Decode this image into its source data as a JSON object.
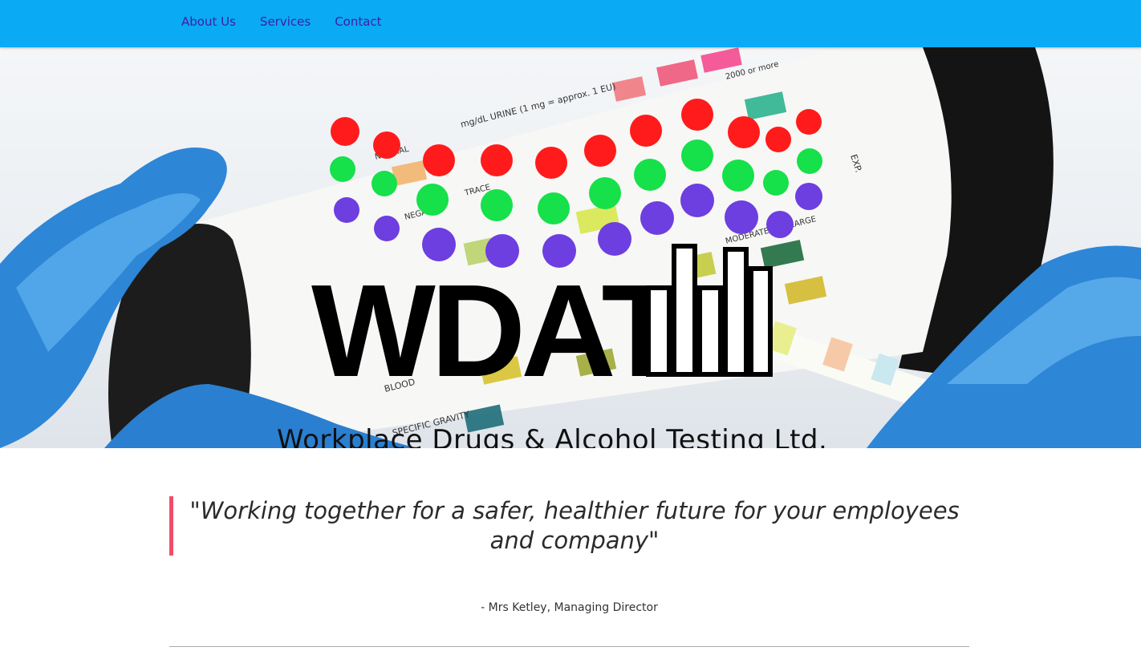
{
  "nav": {
    "items": [
      {
        "label": "About Us"
      },
      {
        "label": "Services"
      },
      {
        "label": "Contact"
      }
    ]
  },
  "hero": {
    "logo_text": "WDAT",
    "tagline": "Workplace Drugs & Alcohol Testing Ltd.",
    "strip_labels": [
      "mg/dL URINE (1 mg = approx. 1 EU)",
      "NORMAL",
      "NEGATIVE",
      "TRACE",
      "MODERATE",
      "LARGE",
      "2000 or more",
      "SPECIFIC GRAVITY",
      "BLOOD",
      "EXP."
    ],
    "dot_colors": {
      "red": "#ff1b1b",
      "green": "#16e04a",
      "purple": "#6d3ee0"
    }
  },
  "quote": {
    "text": "\"Working together for a safer, healthier future for your employees and company\"",
    "author": "- Mrs Ketley, Managing Director"
  },
  "colors": {
    "nav_bg": "#0aaaf5",
    "nav_link": "#3b21a3",
    "quote_bar": "#ef4e6a"
  }
}
